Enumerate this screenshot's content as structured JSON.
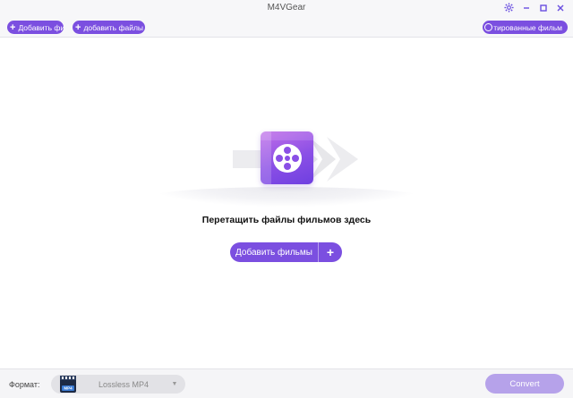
{
  "app": {
    "title": "M4VGear"
  },
  "window_controls": {
    "settings_icon": "gear-icon",
    "minimize_icon": "minimize-icon",
    "maximize_icon": "maximize-icon",
    "close_icon": "close-icon"
  },
  "toolbar": {
    "add_video_label": "Добавить фи",
    "add_files_label": "добавить файлы",
    "converted_label": "онвертированные фильм"
  },
  "main": {
    "drop_text": "Перетащить файлы фильмов здесь",
    "add_movies_label": "Добавить фильмы",
    "add_movies_plus": "+"
  },
  "bottom": {
    "format_label": "Формат:",
    "format_value": "Lossless MP4",
    "mp4_badge": "MP4",
    "convert_label": "Convert"
  },
  "colors": {
    "accent": "#7b4fe0",
    "convert_disabled": "#b6a2ea",
    "film_gradient_start": "#c06ee8",
    "film_gradient_end": "#6e3fe0"
  }
}
